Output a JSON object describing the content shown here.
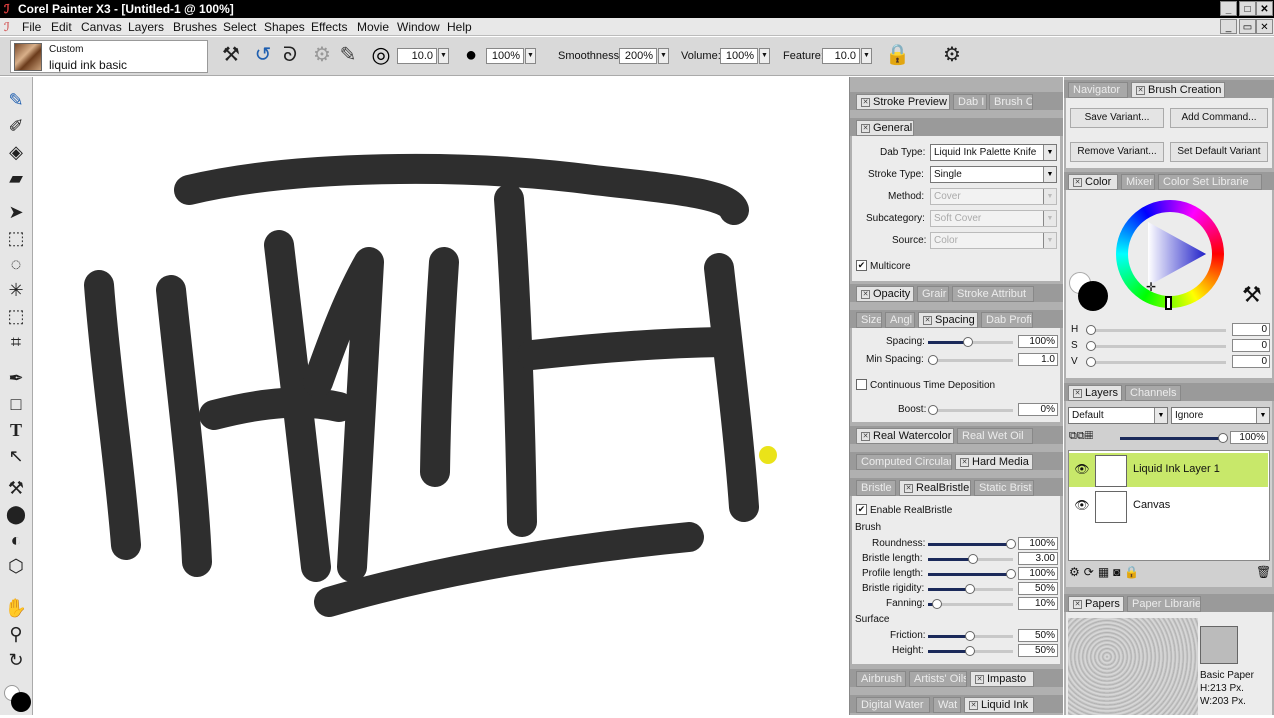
{
  "app": {
    "title": "Corel Painter X3 - [Untitled-1 @ 100%]"
  },
  "menu": [
    "File",
    "Edit",
    "Canvas",
    "Layers",
    "Brushes",
    "Select",
    "Shapes",
    "Effects",
    "Movie",
    "Window",
    "Help"
  ],
  "propbar": {
    "brush_category": "Custom",
    "brush_variant": "liquid ink basic",
    "size": "10.0",
    "opacity": "100%",
    "smoothness_label": "Smoothness:",
    "smoothness": "200%",
    "volume_label": "Volume:",
    "volume": "100%",
    "feature_label": "Feature:",
    "feature": "10.0"
  },
  "panel_left": {
    "tabs1": [
      "Stroke Preview",
      "Dab I",
      "Brush C"
    ],
    "general_tab": "General",
    "dab_type_label": "Dab Type:",
    "dab_type": "Liquid Ink Palette Knife",
    "stroke_type_label": "Stroke Type:",
    "stroke_type": "Single",
    "method_label": "Method:",
    "method": "Cover",
    "subcategory_label": "Subcategory:",
    "subcategory": "Soft Cover",
    "source_label": "Source:",
    "source": "Color",
    "multicore": "Multicore",
    "tabs2": [
      "Opacity",
      "Grair",
      "Stroke Attribut"
    ],
    "tabs3": [
      "Size",
      "Angl",
      "Spacing",
      "Dab Profi"
    ],
    "spacing_label": "Spacing:",
    "spacing": "100%",
    "min_spacing_label": "Min Spacing:",
    "min_spacing": "1.0",
    "ctd": "Continuous Time Deposition",
    "boost_label": "Boost:",
    "boost": "0%",
    "tabs4": [
      "Real Watercolor",
      "Real Wet Oil"
    ],
    "tabs5": [
      "Computed Circular",
      "Hard Media"
    ],
    "tabs6": [
      "Bristle",
      "RealBristle",
      "Static Brist"
    ],
    "enable_rb": "Enable RealBristle",
    "brush_heading": "Brush",
    "roundness_label": "Roundness:",
    "roundness": "100%",
    "bristle_length_label": "Bristle length:",
    "bristle_length": "3.00",
    "profile_length_label": "Profile length:",
    "profile_length": "100%",
    "bristle_rigidity_label": "Bristle rigidity:",
    "bristle_rigidity": "50%",
    "fanning_label": "Fanning:",
    "fanning": "10%",
    "surface_heading": "Surface",
    "friction_label": "Friction:",
    "friction": "50%",
    "height_label": "Height:",
    "height": "50%",
    "tabs7": [
      "Airbrush",
      "Artists' Oils",
      "Impasto"
    ],
    "tabs8": [
      "Digital Water",
      "Wat",
      "Liquid Ink"
    ]
  },
  "panel_right": {
    "tabs1": [
      "Navigator",
      "Brush Creation"
    ],
    "save_variant": "Save Variant...",
    "add_command": "Add Command...",
    "remove_variant": "Remove Variant...",
    "set_default": "Set Default Variant",
    "tabs2": [
      "Color",
      "Mixer",
      "Color Set Librarie"
    ],
    "h_label": "H",
    "h": "0",
    "s_label": "S",
    "s": "0",
    "v_label": "V",
    "v": "0",
    "tabs3": [
      "Layers",
      "Channels"
    ],
    "composite_method": "Default",
    "composite_depth": "Ignore",
    "layer_opacity": "100%",
    "layers": [
      {
        "name": "Liquid Ink Layer 1"
      },
      {
        "name": "Canvas"
      }
    ],
    "tabs4": [
      "Papers",
      "Paper Libraries"
    ],
    "paper_name": "Basic Paper",
    "paper_h": "H:213 Px.",
    "paper_w": "W:203 Px."
  },
  "colors": {
    "accent": "#c8e86a",
    "stroke": "#2e2e2e",
    "panel": "#b0b0b0"
  }
}
